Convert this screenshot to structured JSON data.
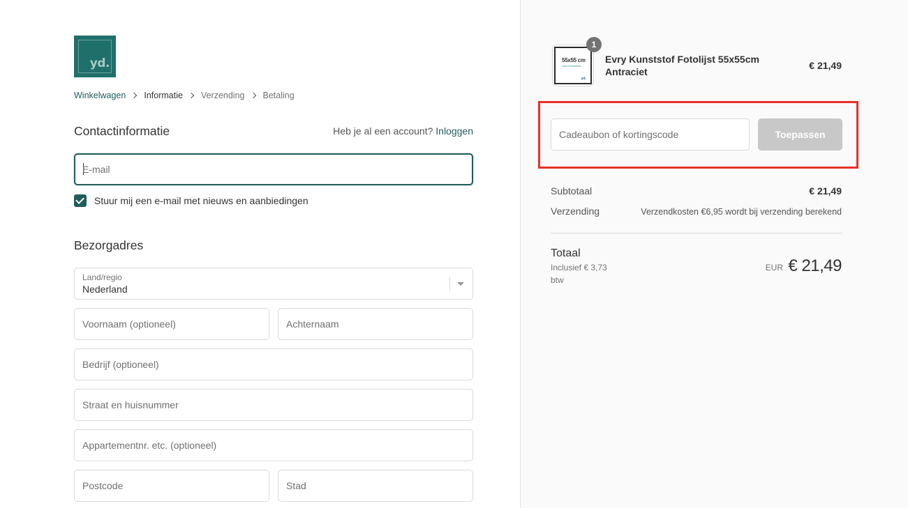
{
  "brand": {
    "logo_text": "yd.",
    "accent": "#1f5d5a"
  },
  "breadcrumb": [
    {
      "label": "Winkelwagen",
      "state": "link"
    },
    {
      "label": "Informatie",
      "state": "active"
    },
    {
      "label": "Verzending",
      "state": "pending"
    },
    {
      "label": "Betaling",
      "state": "pending"
    }
  ],
  "contact": {
    "title": "Contactinformatie",
    "account_prompt": "Heb je al een account?",
    "login_label": "Inloggen",
    "email_placeholder": "E-mail",
    "newsletter_label": "Stuur mij een e-mail met nieuws en aanbiedingen",
    "newsletter_checked": true
  },
  "shipping": {
    "title": "Bezorgadres",
    "country_label": "Land/regio",
    "country_value": "Nederland",
    "first_name_placeholder": "Voornaam (optioneel)",
    "last_name_placeholder": "Achternaam",
    "company_placeholder": "Bedrijf (optioneel)",
    "street_placeholder": "Straat en huisnummer",
    "apartment_placeholder": "Appartementnr. etc. (optioneel)",
    "postcode_placeholder": "Postcode",
    "city_placeholder": "Stad"
  },
  "cart": {
    "item": {
      "quantity": "1",
      "name": "Evry Kunststof Fotolijst 55x55cm Antraciet",
      "price": "€ 21,49",
      "thumb_size_text": "55x55 cm",
      "thumb_sub_text": "Voor Kunstdruk",
      "thumb_logo": "yd."
    },
    "discount_placeholder": "Cadeaubon of kortingscode",
    "apply_label": "Toepassen",
    "subtotal_label": "Subtotaal",
    "subtotal_value": "€ 21,49",
    "shipping_label": "Verzending",
    "shipping_value": "Verzendkosten €6,95 wordt bij verzending berekend",
    "total_label": "Totaal",
    "tax_note": "Inclusief € 3,73 btw",
    "currency": "EUR",
    "total_value": "€ 21,49"
  },
  "colors": {
    "highlight": "#e8302a",
    "panel_bg": "#fafafa",
    "apply_bg": "#c8c8c8"
  }
}
